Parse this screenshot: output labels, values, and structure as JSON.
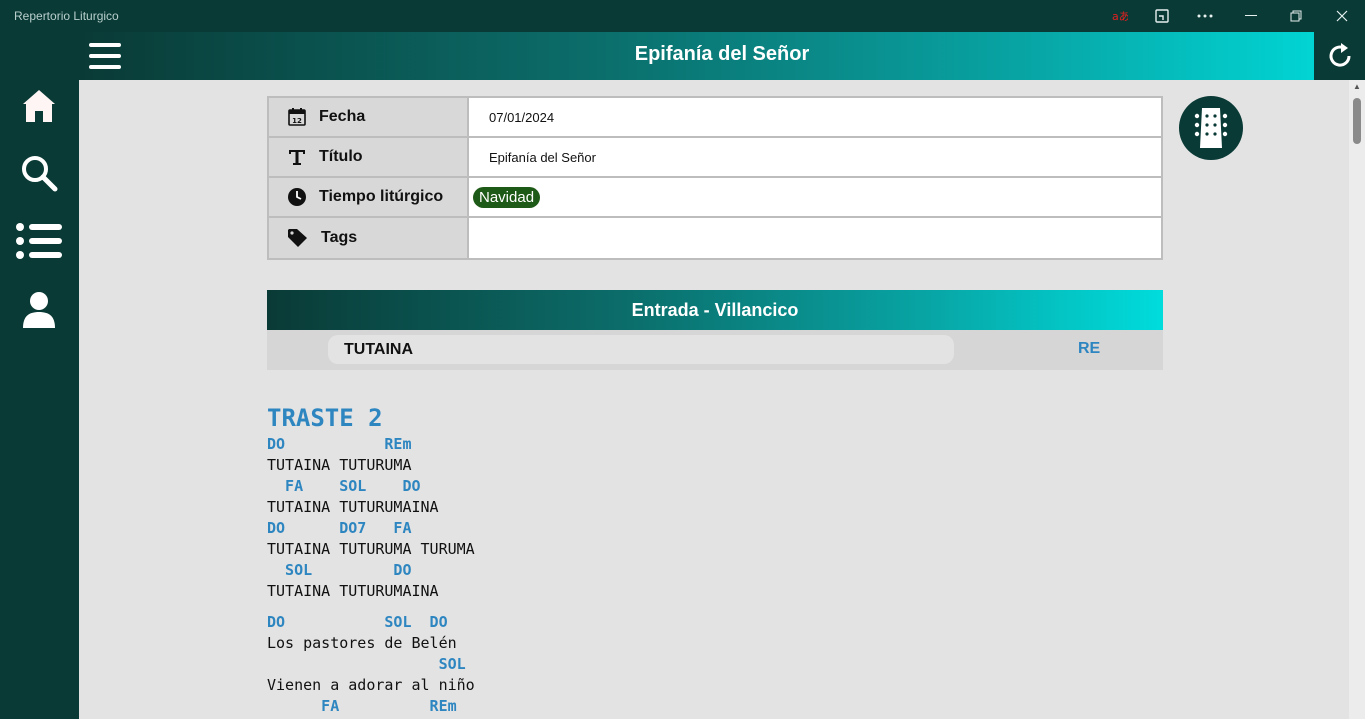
{
  "window": {
    "app_title": "Repertorio Liturgico",
    "controls": [
      "translate-icon",
      "cast-icon",
      "more-icon",
      "minimize-icon",
      "restore-icon",
      "close-icon"
    ]
  },
  "header": {
    "title": "Epifanía del Señor",
    "menu_icon": "hamburger-icon",
    "refresh_icon": "refresh-icon"
  },
  "sidebar": {
    "items": [
      {
        "icon": "home-icon"
      },
      {
        "icon": "search-icon"
      },
      {
        "icon": "list-icon"
      },
      {
        "icon": "user-icon"
      }
    ]
  },
  "info": {
    "fecha_label": "Fecha",
    "fecha_value": "07/01/2024",
    "titulo_label": "Título",
    "titulo_value": "Epifanía del Señor",
    "tiempo_label": "Tiempo litúrgico",
    "tiempo_value": "Navidad",
    "tags_label": "Tags",
    "tags_value": ""
  },
  "section": {
    "title": "Entrada - Villancico",
    "song_name": "TUTAINA",
    "song_key": "RE"
  },
  "lyrics": {
    "capo": "TRASTE 2",
    "lines": [
      {
        "type": "chord",
        "text": "DO           REm"
      },
      {
        "type": "lyric",
        "text": "TUTAINA TUTURUMA"
      },
      {
        "type": "chord",
        "text": "  FA    SOL    DO"
      },
      {
        "type": "lyric",
        "text": "TUTAINA TUTURUMAINA"
      },
      {
        "type": "chord",
        "text": "DO      DO7   FA"
      },
      {
        "type": "lyric",
        "text": "TUTAINA TUTURUMA TURUMA"
      },
      {
        "type": "chord",
        "text": "  SOL         DO"
      },
      {
        "type": "lyric",
        "text": "TUTAINA TUTURUMAINA"
      },
      {
        "type": "gap",
        "text": ""
      },
      {
        "type": "chord",
        "text": "DO           SOL  DO"
      },
      {
        "type": "lyric",
        "text": "Los pastores de Belén"
      },
      {
        "type": "chord",
        "text": "                   SOL"
      },
      {
        "type": "lyric",
        "text": "Vienen a adorar al niño"
      },
      {
        "type": "chord",
        "text": "      FA          REm"
      }
    ]
  },
  "colors": {
    "dark_teal": "#0a3a36",
    "cyan": "#00dcdc",
    "chord_blue": "#2e86c1",
    "badge_green": "#1e5a17"
  }
}
